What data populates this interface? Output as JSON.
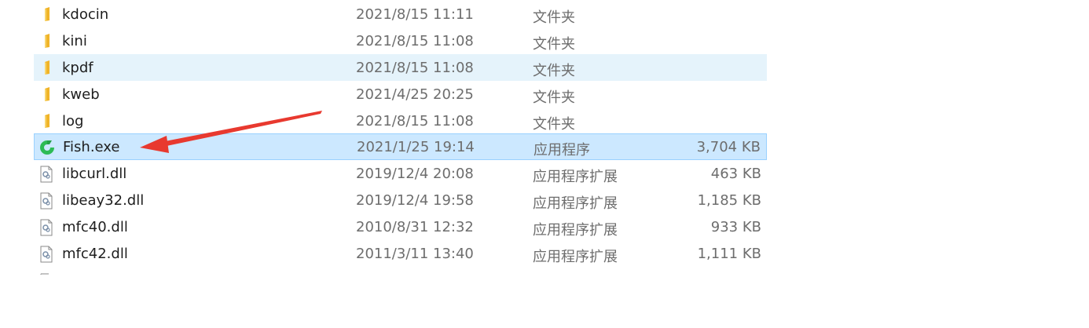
{
  "files": [
    {
      "name": "kdocin",
      "date": "2021/8/15 11:11",
      "type": "文件夹",
      "size": "",
      "icon": "folder-icon"
    },
    {
      "name": "kini",
      "date": "2021/8/15 11:08",
      "type": "文件夹",
      "size": "",
      "icon": "folder-icon"
    },
    {
      "name": "kpdf",
      "date": "2021/8/15 11:08",
      "type": "文件夹",
      "size": "",
      "icon": "folder-icon"
    },
    {
      "name": "kweb",
      "date": "2021/4/25 20:25",
      "type": "文件夹",
      "size": "",
      "icon": "folder-icon"
    },
    {
      "name": "log",
      "date": "2021/8/15 11:08",
      "type": "文件夹",
      "size": "",
      "icon": "folder-icon"
    },
    {
      "name": "Fish.exe",
      "date": "2021/1/25 19:14",
      "type": "应用程序",
      "size": "3,704 KB",
      "icon": "fish-app-icon"
    },
    {
      "name": "libcurl.dll",
      "date": "2019/12/4 20:08",
      "type": "应用程序扩展",
      "size": "463 KB",
      "icon": "dll-file-icon"
    },
    {
      "name": "libeay32.dll",
      "date": "2019/12/4 19:58",
      "type": "应用程序扩展",
      "size": "1,185 KB",
      "icon": "dll-file-icon"
    },
    {
      "name": "mfc40.dll",
      "date": "2010/8/31 12:32",
      "type": "应用程序扩展",
      "size": "933 KB",
      "icon": "dll-file-icon"
    },
    {
      "name": "mfc42.dll",
      "date": "2011/3/11 13:40",
      "type": "应用程序扩展",
      "size": "1,111 KB",
      "icon": "dll-file-icon"
    }
  ],
  "colors": {
    "folder": "#f5c342",
    "fish_green": "#2dbb55",
    "arrow_red": "#e8392f",
    "selected_bg": "#cce8ff",
    "hover_bg": "#e5f3fb"
  }
}
